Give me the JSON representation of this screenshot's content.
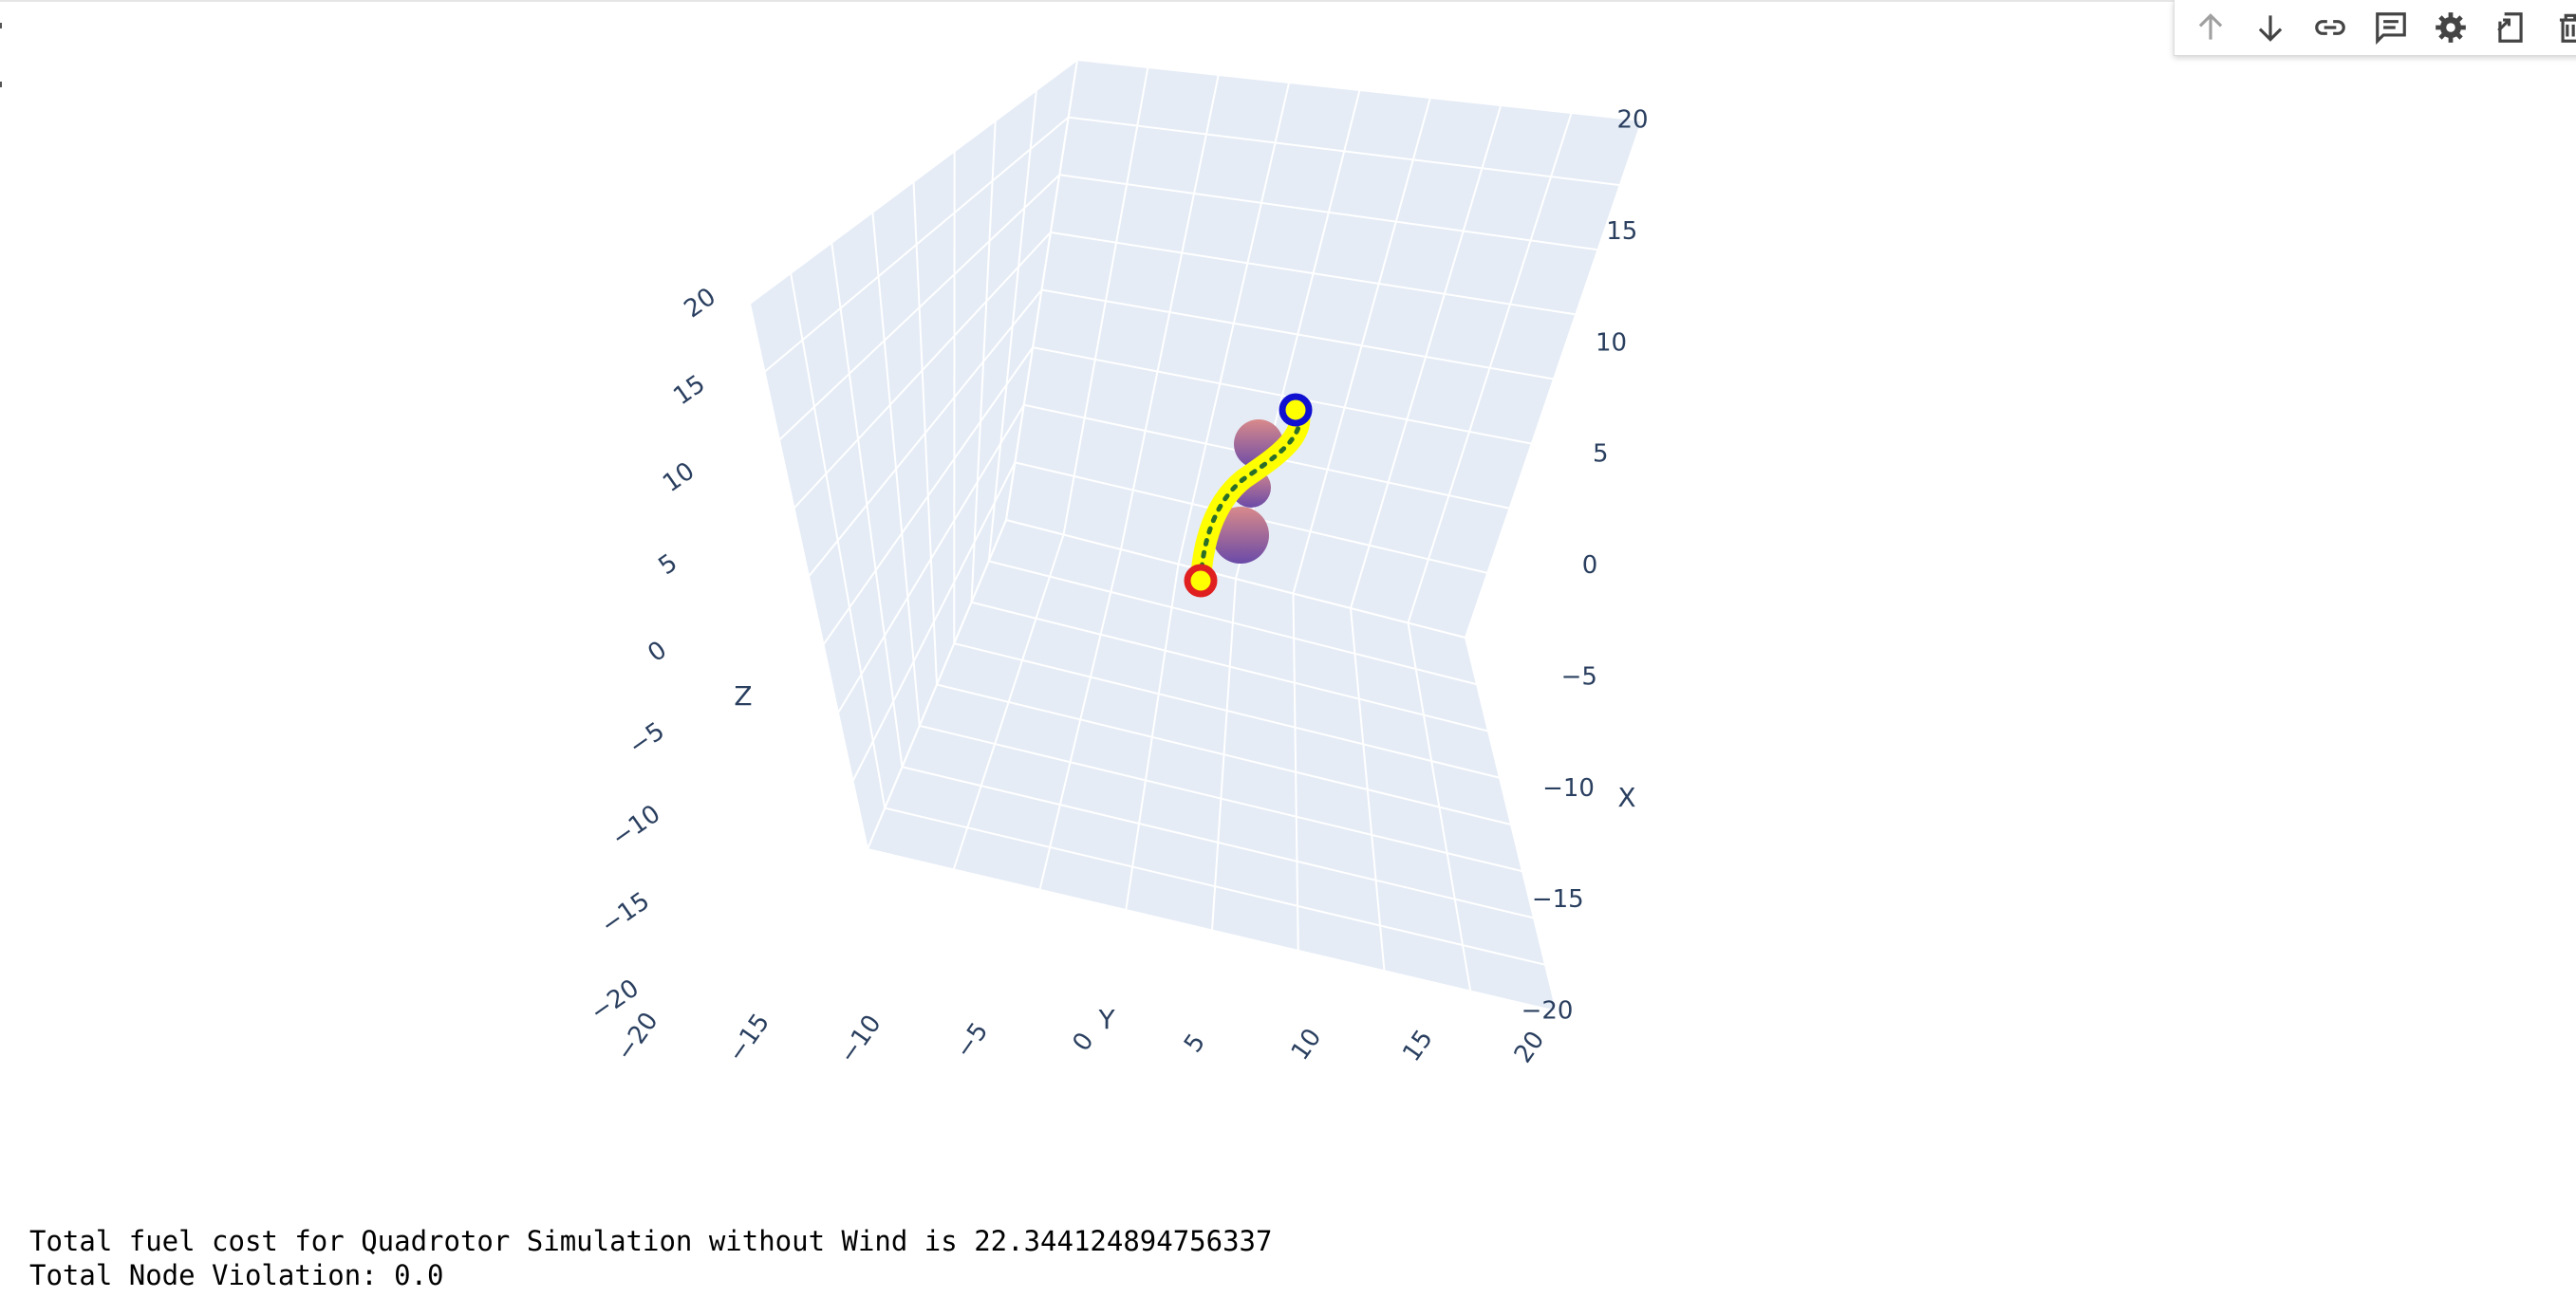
{
  "toolbar": {
    "buttons": [
      {
        "name": "move-up",
        "icon": "arrow-up-icon",
        "enabled": false
      },
      {
        "name": "move-down",
        "icon": "arrow-down-icon",
        "enabled": true
      },
      {
        "name": "copy-link",
        "icon": "link-icon",
        "enabled": true
      },
      {
        "name": "comment",
        "icon": "comment-icon",
        "enabled": true
      },
      {
        "name": "settings",
        "icon": "gear-icon",
        "enabled": true
      },
      {
        "name": "open-in-editor",
        "icon": "open-editor-icon",
        "enabled": true
      },
      {
        "name": "delete",
        "icon": "trash-icon",
        "enabled": true
      }
    ]
  },
  "chart_data": {
    "type": "scatter3d",
    "axes": {
      "x": {
        "title": "X",
        "range": [
          -20,
          20
        ],
        "ticks": [
          "−20",
          "−15",
          "−10",
          "−5",
          "0",
          "5",
          "10",
          "15",
          "20"
        ]
      },
      "y": {
        "title": "Y",
        "range": [
          -20,
          20
        ],
        "ticks": [
          "−20",
          "−15",
          "−10",
          "−5",
          "0",
          "5",
          "10",
          "15",
          "20"
        ]
      },
      "z": {
        "title": "Z",
        "range": [
          -20,
          20
        ],
        "ticks": [
          "−20",
          "−15",
          "−10",
          "−5",
          "0",
          "5",
          "10",
          "15",
          "20"
        ]
      }
    },
    "scene_background": "#e5ecf6",
    "grid": true,
    "start_marker": {
      "color": "#e02020",
      "fill": "#ffff00"
    },
    "goal_marker": {
      "color": "#1010d0",
      "fill": "#ffff00"
    },
    "trajectory": {
      "color": "#ffff00",
      "center_line": "#2a6e2a",
      "line_style": "dotted"
    },
    "obstacles": {
      "count": 3,
      "color_top": "#d98a8a",
      "color_bottom": "#6a4aa8"
    }
  },
  "output": {
    "line1": "Total fuel cost for Quadrotor Simulation without Wind is 22.344124894756337",
    "line2": "Total Node Violation: 0.0"
  }
}
